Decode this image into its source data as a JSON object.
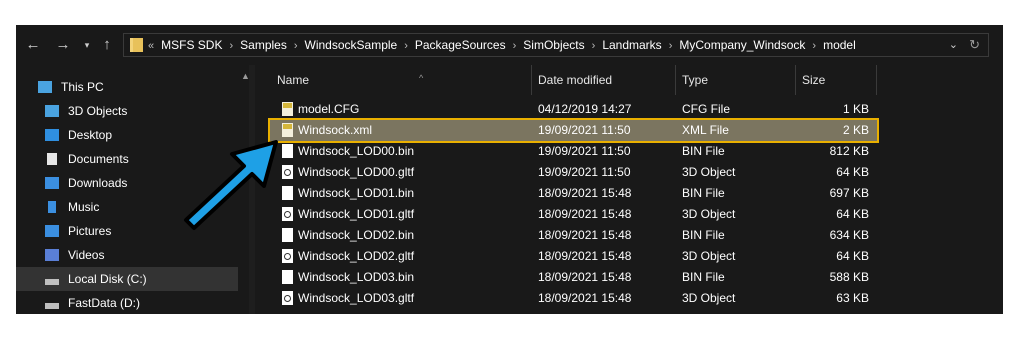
{
  "nav": {
    "back_icon": "arrow-left-icon",
    "forward_icon": "arrow-right-icon",
    "recent_icon": "chevron-down-icon",
    "up_icon": "arrow-up-icon"
  },
  "address": {
    "overflow": "«",
    "crumbs": [
      "MSFS SDK",
      "Samples",
      "WindsockSample",
      "PackageSources",
      "SimObjects",
      "Landmarks",
      "MyCompany_Windsock",
      "model"
    ],
    "separator": "›"
  },
  "sidebar": {
    "items": [
      {
        "label": "This PC",
        "icon": "computer-icon"
      },
      {
        "label": "3D Objects",
        "icon": "cube-icon"
      },
      {
        "label": "Desktop",
        "icon": "desktop-icon"
      },
      {
        "label": "Documents",
        "icon": "document-icon"
      },
      {
        "label": "Downloads",
        "icon": "download-icon"
      },
      {
        "label": "Music",
        "icon": "music-icon"
      },
      {
        "label": "Pictures",
        "icon": "pictures-icon"
      },
      {
        "label": "Videos",
        "icon": "videos-icon"
      },
      {
        "label": "Local Disk (C:)",
        "icon": "drive-icon"
      },
      {
        "label": "FastData (D:)",
        "icon": "drive-icon"
      }
    ],
    "selected": "Local Disk (C:)"
  },
  "columns": {
    "name": "Name",
    "date": "Date modified",
    "type": "Type",
    "size": "Size"
  },
  "files": [
    {
      "name": "model.CFG",
      "date": "04/12/2019 14:27",
      "type": "CFG File",
      "size": "1 KB",
      "icon": "config-file-icon"
    },
    {
      "name": "Windsock.xml",
      "date": "19/09/2021 11:50",
      "type": "XML File",
      "size": "2 KB",
      "icon": "xml-file-icon"
    },
    {
      "name": "Windsock_LOD00.bin",
      "date": "19/09/2021 11:50",
      "type": "BIN File",
      "size": "812 KB",
      "icon": "file-icon"
    },
    {
      "name": "Windsock_LOD00.gltf",
      "date": "19/09/2021 11:50",
      "type": "3D Object",
      "size": "64 KB",
      "icon": "3d-object-icon"
    },
    {
      "name": "Windsock_LOD01.bin",
      "date": "18/09/2021 15:48",
      "type": "BIN File",
      "size": "697 KB",
      "icon": "file-icon"
    },
    {
      "name": "Windsock_LOD01.gltf",
      "date": "18/09/2021 15:48",
      "type": "3D Object",
      "size": "64 KB",
      "icon": "3d-object-icon"
    },
    {
      "name": "Windsock_LOD02.bin",
      "date": "18/09/2021 15:48",
      "type": "BIN File",
      "size": "634 KB",
      "icon": "file-icon"
    },
    {
      "name": "Windsock_LOD02.gltf",
      "date": "18/09/2021 15:48",
      "type": "3D Object",
      "size": "64 KB",
      "icon": "3d-object-icon"
    },
    {
      "name": "Windsock_LOD03.bin",
      "date": "18/09/2021 15:48",
      "type": "BIN File",
      "size": "588 KB",
      "icon": "file-icon"
    },
    {
      "name": "Windsock_LOD03.gltf",
      "date": "18/09/2021 15:48",
      "type": "3D Object",
      "size": "63 KB",
      "icon": "3d-object-icon"
    }
  ],
  "highlighted_file": "Windsock.xml",
  "colors": {
    "window_bg": "#191919",
    "highlight_fill": "#7b7560",
    "highlight_border": "#e9b000",
    "arrow": "#1ea0e6"
  }
}
